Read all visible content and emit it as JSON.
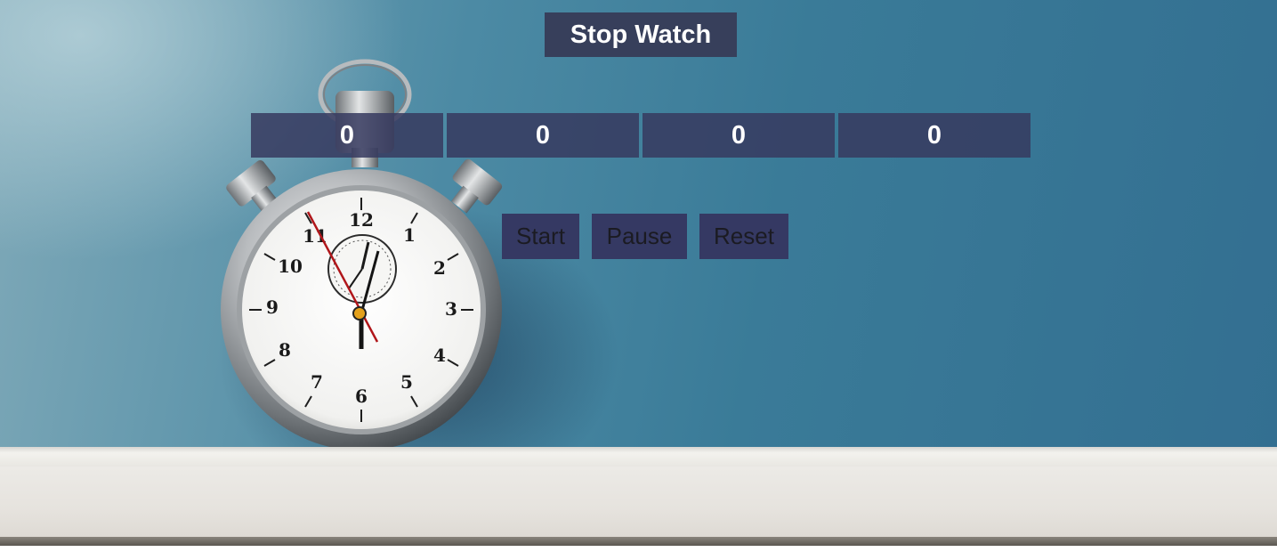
{
  "title": "Stop Watch",
  "digits": [
    "0",
    "0",
    "0",
    "0"
  ],
  "buttons": {
    "start": "Start",
    "pause": "Pause",
    "reset": "Reset"
  },
  "background": {
    "wall_color": "#3a7b98",
    "panel_color": "#373f5b",
    "shelf_color": "#e9e7e2",
    "clock_numerals": [
      "12",
      "1",
      "2",
      "3",
      "4",
      "5",
      "6",
      "7",
      "8",
      "9",
      "10",
      "11"
    ]
  }
}
